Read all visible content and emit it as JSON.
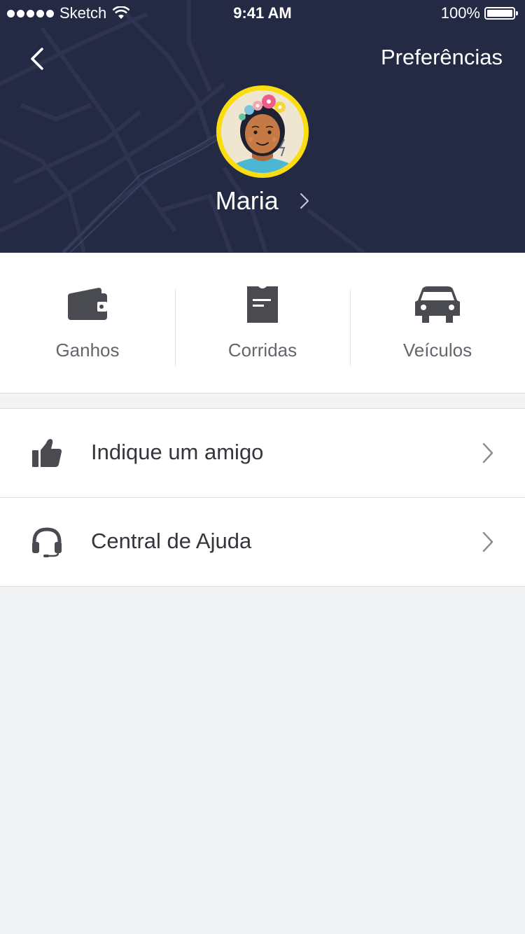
{
  "status_bar": {
    "carrier": "Sketch",
    "time": "9:41 AM",
    "battery": "100%"
  },
  "header": {
    "back_icon": "chevron-left-icon",
    "preferences_label": "Preferências",
    "user_name": "Maria",
    "accent_color": "#f9dd10",
    "background_color": "#252a44"
  },
  "quick_actions": [
    {
      "label": "Ganhos",
      "icon": "wallet-icon"
    },
    {
      "label": "Corridas",
      "icon": "receipt-icon"
    },
    {
      "label": "Veículos",
      "icon": "car-icon"
    }
  ],
  "menu": [
    {
      "label": "Indique um amigo",
      "icon": "thumbs-up-icon"
    },
    {
      "label": "Central de Ajuda",
      "icon": "headset-icon"
    }
  ]
}
